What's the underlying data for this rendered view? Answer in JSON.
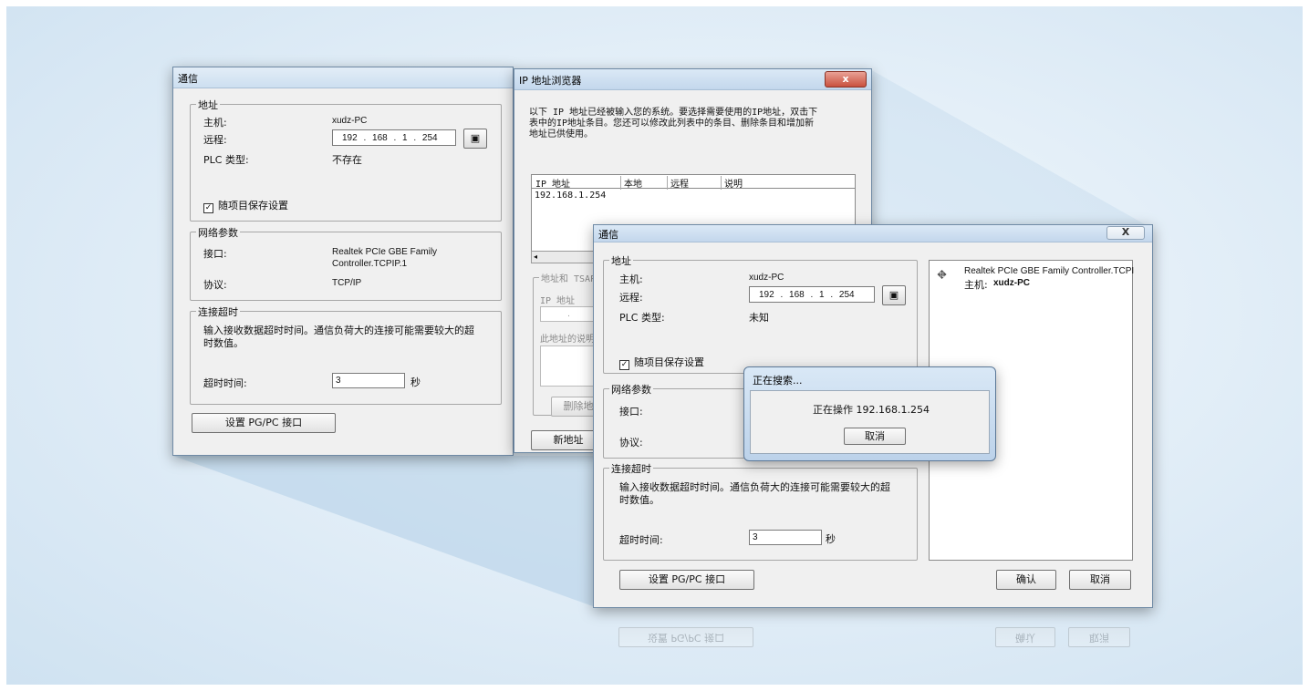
{
  "win1": {
    "title": "通信",
    "address_group": "地址",
    "host_label": "主机:",
    "host_value": "xudz-PC",
    "remote_label": "远程:",
    "remote_ip": "192 . 168 . 1 . 254",
    "plc_label": "PLC 类型:",
    "plc_value": "不存在",
    "save_checkbox": "随项目保存设置",
    "net_group": "网络参数",
    "interface_label": "接口:",
    "interface_value_line1": "Realtek PCIe GBE Family",
    "interface_value_line2": "Controller.TCPIP.1",
    "protocol_label": "协议:",
    "protocol_value": "TCP/IP",
    "timeout_group": "连接超时",
    "timeout_desc_line1": "输入接收数据超时时间。通信负荷大的连接可能需要较大的超",
    "timeout_desc_line2": "时数值。",
    "timeout_label": "超时时间:",
    "timeout_value": "3",
    "timeout_unit": "秒",
    "set_pgpc_button": "设置 PG/PC 接口"
  },
  "win2": {
    "title": "IP 地址浏览器",
    "close_label": "x",
    "desc_line1": "以下 IP 地址已经被输入您的系统。要选择需要使用的IP地址，双击下",
    "desc_line2": "表中的IP地址条目。您还可以修改此列表中的条目、删除条目和增加新",
    "desc_line3": "地址已供使用。",
    "columns": [
      "IP 地址",
      "本地",
      "远程",
      "说明"
    ],
    "rows": [
      "192.168.1.254"
    ],
    "addr_tsap_group": "地址和 TSAP",
    "ip_addr_label": "IP 地址",
    "ip_placeholder": ".",
    "addr_desc_label": "此地址的说明",
    "delete_button": "删除地",
    "new_button": "新地址"
  },
  "win3": {
    "title": "通信",
    "close_label": "X",
    "address_group": "地址",
    "host_label": "主机:",
    "host_value": "xudz-PC",
    "remote_label": "远程:",
    "remote_ip": "192 . 168 . 1 . 254",
    "plc_label": "PLC 类型:",
    "plc_value": "未知",
    "save_checkbox": "随项目保存设置",
    "net_group": "网络参数",
    "interface_label": "接口:",
    "protocol_label": "协议:",
    "timeout_group": "连接超时",
    "timeout_desc_line1": "输入接收数据超时时间。通信负荷大的连接可能需要较大的超",
    "timeout_desc_line2": "时数值。",
    "timeout_label": "超时时间:",
    "timeout_value": "3",
    "timeout_unit": "秒",
    "set_pgpc_button": "设置 PG/PC 接口",
    "ok_button": "确认",
    "cancel_button": "取消",
    "tree_item": "Realtek PCIe GBE Family Controller.TCPI",
    "tree_host_label": "主机:",
    "tree_host_value": "xudz-PC"
  },
  "search_dialog": {
    "title": "正在搜索...",
    "message": "正在操作 192.168.1.254",
    "cancel_button": "取消"
  },
  "icons": {
    "address_book": "address-book-icon",
    "network_card": "network-card-icon"
  },
  "colors": {
    "close_red": "#c9513f",
    "title_blue": "#c3d7ec",
    "background": "#dfecf6"
  }
}
